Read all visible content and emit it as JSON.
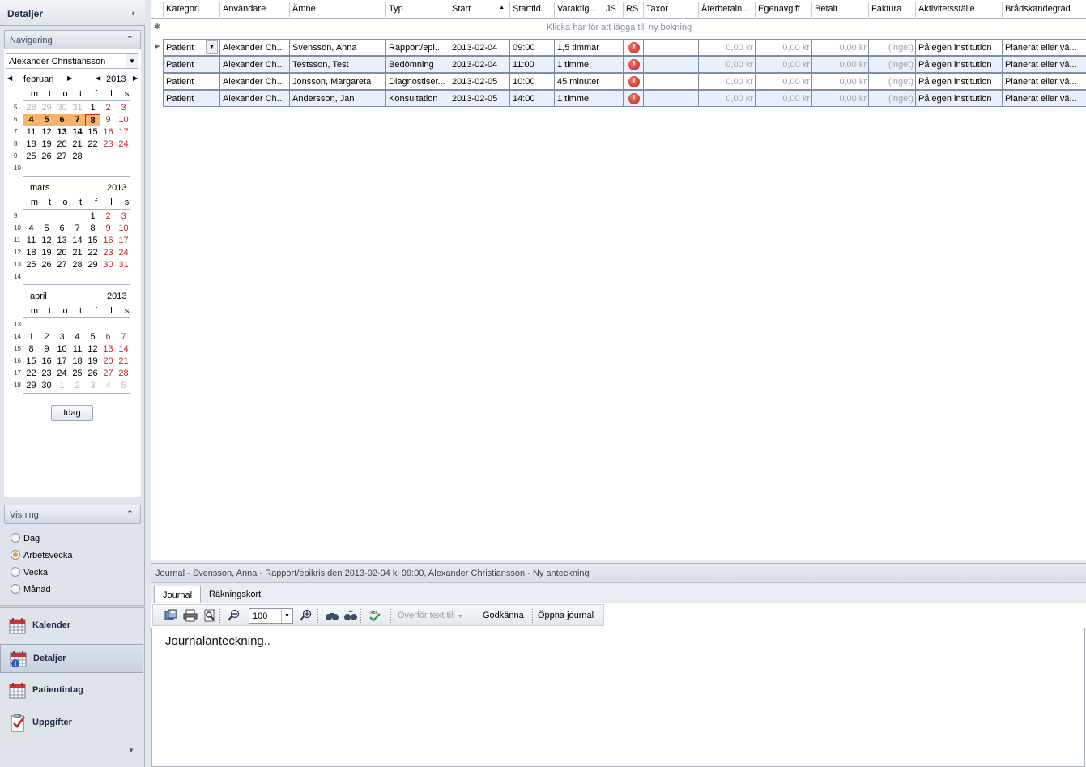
{
  "left_panel": {
    "title": "Detaljer",
    "navigation": {
      "header": "Navigering",
      "user_select": "Alexander Christiansson",
      "weekday_headers": [
        "m",
        "t",
        "o",
        "t",
        "f",
        "l",
        "s"
      ],
      "months": [
        {
          "name": "februari",
          "year": "2013",
          "weeks": [
            "5",
            "6",
            "7",
            "8",
            "9",
            "10"
          ],
          "days": [
            [
              "28",
              "29",
              "30",
              "31",
              "1",
              "2",
              "3"
            ],
            [
              "4",
              "5",
              "6",
              "7",
              "8",
              "9",
              "10"
            ],
            [
              "11",
              "12",
              "13",
              "14",
              "15",
              "16",
              "17"
            ],
            [
              "18",
              "19",
              "20",
              "21",
              "22",
              "23",
              "24"
            ],
            [
              "25",
              "26",
              "27",
              "28",
              "",
              "",
              ""
            ],
            [
              "",
              "",
              "",
              "",
              "",
              "",
              ""
            ]
          ]
        },
        {
          "name": "mars",
          "year": "2013",
          "weeks": [
            "9",
            "10",
            "11",
            "12",
            "13",
            "14"
          ],
          "days": [
            [
              "",
              "",
              "",
              "",
              "1",
              "2",
              "3"
            ],
            [
              "4",
              "5",
              "6",
              "7",
              "8",
              "9",
              "10"
            ],
            [
              "11",
              "12",
              "13",
              "14",
              "15",
              "16",
              "17"
            ],
            [
              "18",
              "19",
              "20",
              "21",
              "22",
              "23",
              "24"
            ],
            [
              "25",
              "26",
              "27",
              "28",
              "29",
              "30",
              "31"
            ],
            [
              "",
              "",
              "",
              "",
              "",
              "",
              ""
            ]
          ]
        },
        {
          "name": "april",
          "year": "2013",
          "weeks": [
            "13",
            "14",
            "15",
            "16",
            "17",
            "18"
          ],
          "days": [
            [
              "",
              "",
              "",
              "",
              "",
              "",
              ""
            ],
            [
              "1",
              "2",
              "3",
              "4",
              "5",
              "6",
              "7"
            ],
            [
              "8",
              "9",
              "10",
              "11",
              "12",
              "13",
              "14"
            ],
            [
              "15",
              "16",
              "17",
              "18",
              "19",
              "20",
              "21"
            ],
            [
              "22",
              "23",
              "24",
              "25",
              "26",
              "27",
              "28"
            ],
            [
              "29",
              "30",
              "1",
              "2",
              "3",
              "4",
              "5"
            ]
          ]
        }
      ],
      "today_button": "Idag"
    },
    "view": {
      "header": "Visning",
      "options": [
        "Dag",
        "Arbetsvecka",
        "Vecka",
        "Månad"
      ],
      "selected": "Arbetsvecka"
    },
    "nav_buttons": [
      {
        "label": "Kalender",
        "icon": "calendar-icon"
      },
      {
        "label": "Detaljer",
        "icon": "calendar-info-icon",
        "active": true
      },
      {
        "label": "Patientintag",
        "icon": "calendar-icon"
      },
      {
        "label": "Uppgifter",
        "icon": "clipboard-check-icon"
      }
    ]
  },
  "grid": {
    "columns": [
      "Kategori",
      "Användare",
      "Ämne",
      "Typ",
      "Start",
      "Starttid",
      "Varaktig...",
      "JS",
      "RS",
      "Taxor",
      "Återbetaln...",
      "Egenavgift",
      "Betalt",
      "Faktura",
      "Aktivitetsställe",
      "Brådskandegrad"
    ],
    "sorted_column": "Start",
    "new_row_text": "Klicka här för att lägga till ny bokning",
    "rows": [
      {
        "kategori": "Patient",
        "anvandare": "Alexander Ch...",
        "amne": "Svensson, Anna",
        "typ": "Rapport/epi...",
        "start": "2013-02-04",
        "starttid": "09:00",
        "varaktighet": "1,5 timmar",
        "js": "",
        "rs": "!",
        "taxor": "",
        "aterbetalning": "0,00 kr",
        "egenavgift": "0,00 kr",
        "betalt": "0,00 kr",
        "faktura": "(inget)",
        "aktivitetsstalle": "På egen institution",
        "bradskandegrad": "Planerat eller vä..."
      },
      {
        "kategori": "Patient",
        "anvandare": "Alexander Ch...",
        "amne": "Testsson, Test",
        "typ": "Bedömning",
        "start": "2013-02-04",
        "starttid": "11:00",
        "varaktighet": "1 timme",
        "js": "",
        "rs": "!",
        "taxor": "",
        "aterbetalning": "0,00 kr",
        "egenavgift": "0,00 kr",
        "betalt": "0,00 kr",
        "faktura": "(inget)",
        "aktivitetsstalle": "På egen institution",
        "bradskandegrad": "Planerat eller vä..."
      },
      {
        "kategori": "Patient",
        "anvandare": "Alexander Ch...",
        "amne": "Jonsson, Margareta",
        "typ": "Diagnostiser...",
        "start": "2013-02-05",
        "starttid": "10:00",
        "varaktighet": "45 minuter",
        "js": "",
        "rs": "!",
        "taxor": "",
        "aterbetalning": "0,00 kr",
        "egenavgift": "0,00 kr",
        "betalt": "0,00 kr",
        "faktura": "(inget)",
        "aktivitetsstalle": "På egen institution",
        "bradskandegrad": "Planerat eller vä..."
      },
      {
        "kategori": "Patient",
        "anvandare": "Alexander Ch...",
        "amne": "Andersson, Jan",
        "typ": "Konsultation",
        "start": "2013-02-05",
        "starttid": "14:00",
        "varaktighet": "1 timme",
        "js": "",
        "rs": "!",
        "taxor": "",
        "aterbetalning": "0,00 kr",
        "egenavgift": "0,00 kr",
        "betalt": "0,00 kr",
        "faktura": "(inget)",
        "aktivitetsstalle": "På egen institution",
        "bradskandegrad": "Planerat eller vä..."
      }
    ]
  },
  "journal": {
    "title": "Journal - Svensson, Anna - Rapport/epikris den 2013-02-04 kl 09:00, Alexander Christiansson - Ny anteckning",
    "tabs": [
      "Journal",
      "Räkningskort"
    ],
    "active_tab": "Journal",
    "toolbar": {
      "zoom": "100",
      "transfer_label": "Överför text till",
      "approve_label": "Godkänna",
      "open_label": "Öppna journal"
    },
    "content": "Journalanteckning.."
  },
  "colors": {
    "selected_day": "#f8b36c",
    "weekend": "#c0282d",
    "row_alt": "#e9f0fb",
    "radio_on": "#f2a31a"
  }
}
